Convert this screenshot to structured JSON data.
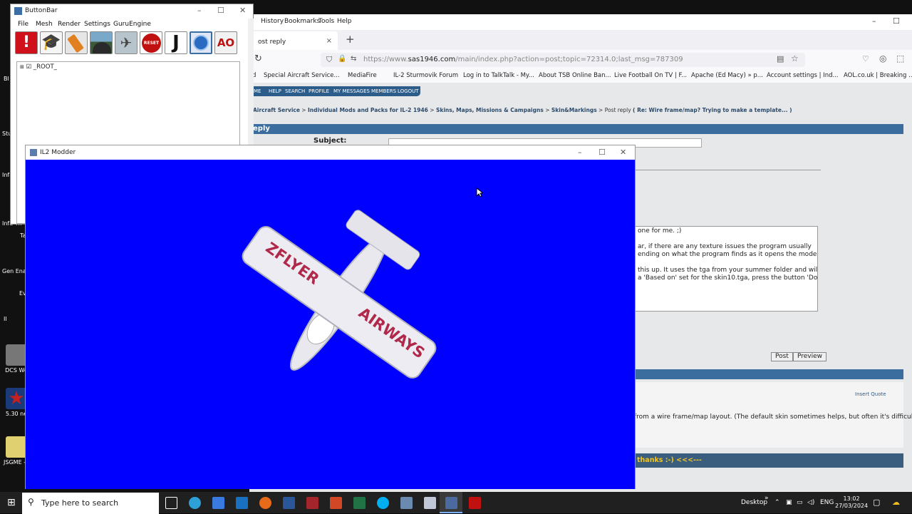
{
  "desktop": {
    "icons": [
      {
        "label": "DCS Wo",
        "color": "#777777"
      },
      {
        "label": "5.30 ne",
        "color": "#c42020"
      },
      {
        "label": "JSGME - I",
        "color": "#e0d070"
      }
    ],
    "edge_labels": [
      "Bl",
      "Stu",
      "Infa",
      "Infa Th",
      "Gen Ena",
      "Ev",
      "Il",
      "Ta"
    ]
  },
  "firefox": {
    "menu": [
      "History",
      "Bookmarks",
      "Tools",
      "Help"
    ],
    "tab_title": "ost reply",
    "tab_close": "×",
    "new_tab": "+",
    "url_domain": "sas1946.com",
    "url_prefix": "https://www.",
    "url_path": "/main/index.php?action=post;topic=72314.0;last_msg=787309",
    "bookmarks": [
      "d",
      "Special Aircraft Service...",
      "MediaFire",
      "IL-2 Sturmovik Forum",
      "Log in to TalkTalk - My...",
      "About TSB Online Ban...",
      "Live Football On TV | F...",
      "Apache (Ed Macy) » p...",
      "Account settings | Ind...",
      "AOL.co.uk | Breaking ..."
    ],
    "forum_nav": [
      "ME",
      "HELP",
      "SEARCH",
      "PROFILE",
      "MY MESSAGES",
      "MEMBERS",
      "LOGOUT"
    ],
    "breadcrumbs": {
      "a": "Aircraft Service",
      "b": "Individual Mods and Packs for IL-2 1946",
      "c": "Skins, Maps, Missions & Campaigns",
      "d": "Skin&Markings",
      "e": "Post reply",
      "f": "( Re: Wire frame/map? Trying to make a template... )"
    },
    "reply_heading": "eply",
    "subject_label": "Subject:",
    "message_lines": [
      " one for me. ;)",
      "",
      "ar, if there are any texture issues the program usually",
      "ending on what the program finds as it opens the model,",
      "",
      "this up. It uses the tga from your summer folder and will",
      "a 'Based on' set for the skin10.tga, press the button 'Do"
    ],
    "post_button": "Post",
    "preview_button": "Preview",
    "insert_quote": "Insert Quote",
    "quote_text": "from a wire frame/map layout. (The default skin sometimes helps, but often it's difficult to find",
    "thanks_text": "thanks :-)    <<<---"
  },
  "buttonbar": {
    "title": "ButtonBar",
    "menu": [
      "File",
      "Mesh",
      "Render",
      "Settings",
      "GuruEngine"
    ],
    "tools": [
      {
        "name": "alert-tool",
        "color": "#d0101a",
        "text": "!"
      },
      {
        "name": "graduation-cap-tool",
        "color": "#1a1a1a",
        "text": ""
      },
      {
        "name": "eraser-tool",
        "color": "#e08020",
        "text": ""
      },
      {
        "name": "cockpit-tool",
        "color": "#5a8aaa",
        "text": ""
      },
      {
        "name": "aircraft-tool",
        "color": "#8a9aaa",
        "text": ""
      },
      {
        "name": "reset-tool",
        "color": "#c01010",
        "text": "RESET"
      },
      {
        "name": "hook-tool",
        "color": "#111111",
        "text": "J"
      },
      {
        "name": "globe-tool",
        "color": "#2a6ac0",
        "text": ""
      },
      {
        "name": "ao-tool",
        "color": "#f2f2f2",
        "text": "AO"
      }
    ],
    "tree_root": "_ROOT_"
  },
  "il2": {
    "title": "IL2 Modder",
    "viewport_color": "#0000ff",
    "wing_text_left": "ZFLYER",
    "wing_text_right": "AIRWAYS"
  },
  "taskbar": {
    "search_placeholder": "Type here to search",
    "desktop_label": "Desktop",
    "lang": "ENG",
    "time": "13:02",
    "date": "27/03/2024"
  }
}
